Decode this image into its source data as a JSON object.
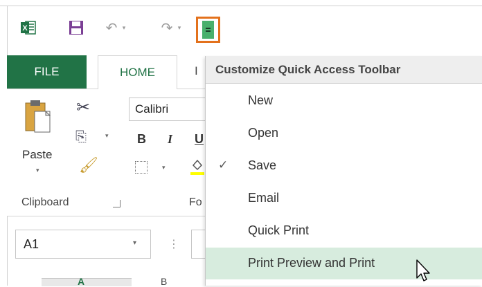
{
  "quick_access": {
    "excel_icon": "excel-logo-icon",
    "save_icon": "save-icon",
    "undo_icon": "undo-icon",
    "redo_icon": "redo-icon",
    "customize_icon": "customize-quick-access-icon",
    "undo_glyph": "↶",
    "redo_glyph": "↷",
    "dd_glyph": "▾"
  },
  "ribbon": {
    "tabs": [
      {
        "label": "FILE"
      },
      {
        "label": "HOME"
      },
      {
        "label": "I"
      }
    ],
    "clipboard": {
      "paste_label": "Paste",
      "group_label": "Clipboard",
      "cut_glyph": "✂",
      "copy_glyph": "⎘",
      "format_glyph": "🖌"
    },
    "font": {
      "font_name": "Calibri",
      "bold": "B",
      "italic": "I",
      "underline": "U",
      "group_label": "Fo"
    }
  },
  "formula_bar": {
    "name_box": "A1",
    "dots": "⋮"
  },
  "grid": {
    "col_a": "A",
    "col_b": "B"
  },
  "menu": {
    "header": "Customize Quick Access Toolbar",
    "items": [
      {
        "label": "New",
        "checked": false
      },
      {
        "label": "Open",
        "checked": false
      },
      {
        "label": "Save",
        "checked": true,
        "check_glyph": "✓"
      },
      {
        "label": "Email",
        "checked": false
      },
      {
        "label": "Quick Print",
        "checked": false
      },
      {
        "label": "Print Preview and Print",
        "checked": false,
        "highlighted": true
      }
    ]
  },
  "colors": {
    "accent_green": "#217346",
    "highlight_orange": "#e3711c",
    "menu_hover": "#d7ecde",
    "save_purple": "#7b3f95"
  }
}
